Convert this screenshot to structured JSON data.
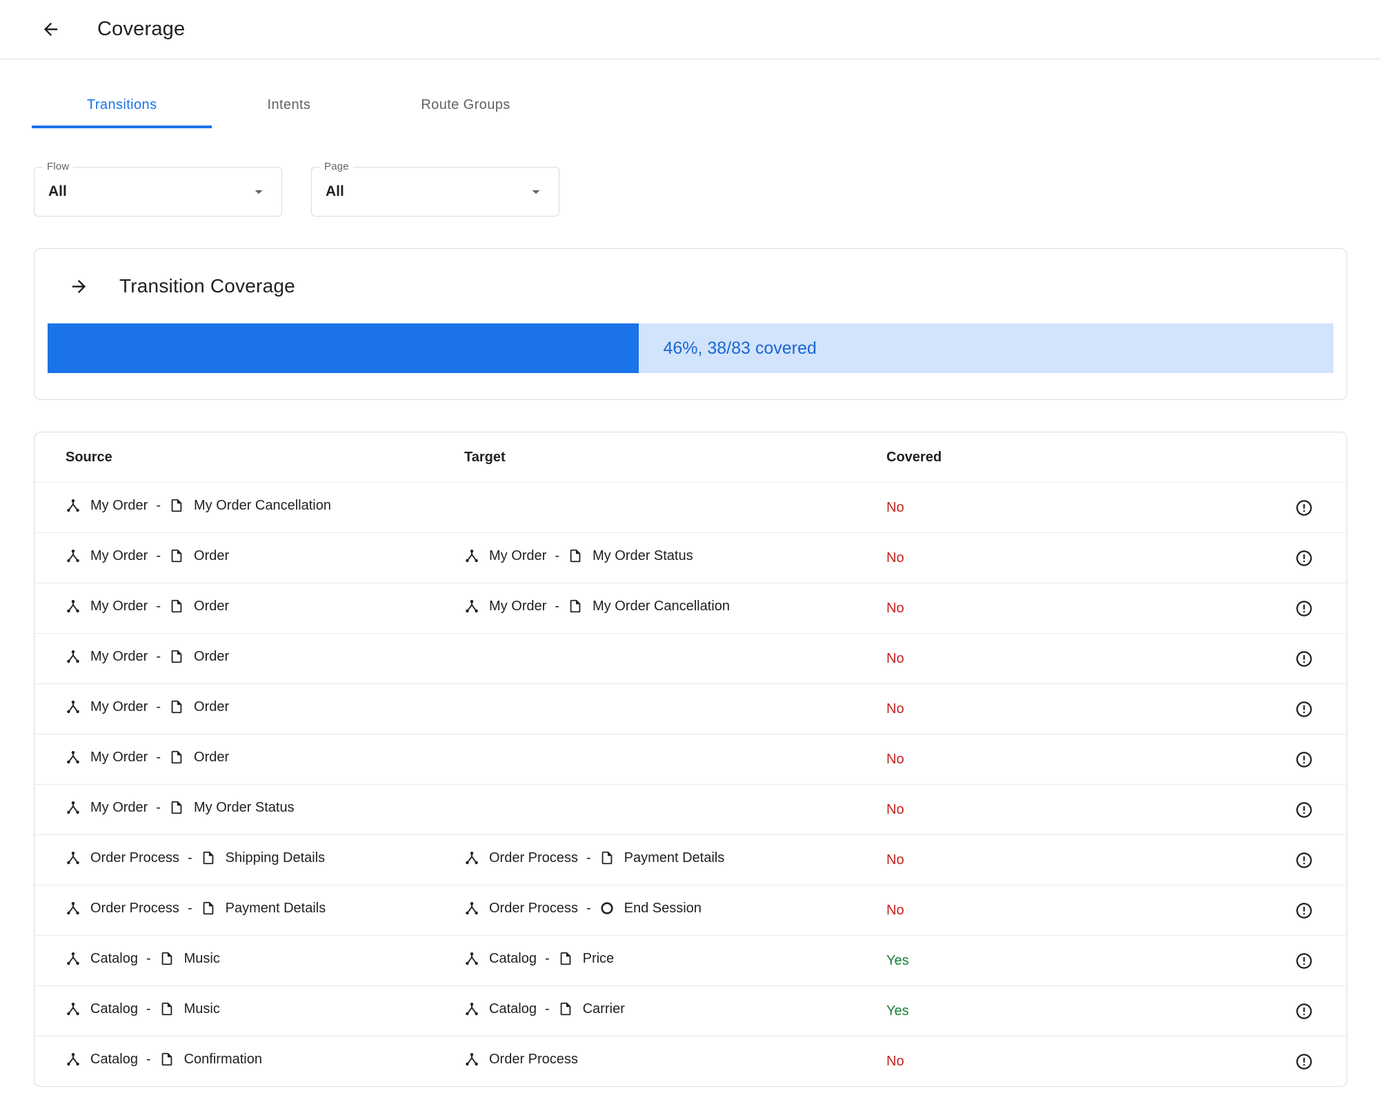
{
  "header": {
    "title": "Coverage"
  },
  "tabs": [
    {
      "label": "Transitions",
      "active": true
    },
    {
      "label": "Intents",
      "active": false
    },
    {
      "label": "Route Groups",
      "active": false
    }
  ],
  "filters": {
    "flow": {
      "label": "Flow",
      "value": "All"
    },
    "page": {
      "label": "Page",
      "value": "All"
    }
  },
  "coverage_card": {
    "title": "Transition Coverage",
    "progress_percent": 46,
    "progress_label": "46%, 38/83 covered"
  },
  "table": {
    "columns": [
      "Source",
      "Target",
      "Covered"
    ],
    "rows": [
      {
        "source": {
          "flow": "My Order",
          "page": "My Order Cancellation",
          "page_icon": "page"
        },
        "target": null,
        "covered": "No"
      },
      {
        "source": {
          "flow": "My Order",
          "page": "Order",
          "page_icon": "page"
        },
        "target": {
          "flow": "My Order",
          "page": "My Order Status",
          "page_icon": "page"
        },
        "covered": "No"
      },
      {
        "source": {
          "flow": "My Order",
          "page": "Order",
          "page_icon": "page"
        },
        "target": {
          "flow": "My Order",
          "page": "My Order Cancellation",
          "page_icon": "page"
        },
        "covered": "No"
      },
      {
        "source": {
          "flow": "My Order",
          "page": "Order",
          "page_icon": "page"
        },
        "target": null,
        "covered": "No"
      },
      {
        "source": {
          "flow": "My Order",
          "page": "Order",
          "page_icon": "page"
        },
        "target": null,
        "covered": "No"
      },
      {
        "source": {
          "flow": "My Order",
          "page": "Order",
          "page_icon": "page"
        },
        "target": null,
        "covered": "No"
      },
      {
        "source": {
          "flow": "My Order",
          "page": "My Order Status",
          "page_icon": "page"
        },
        "target": null,
        "covered": "No"
      },
      {
        "source": {
          "flow": "Order Process",
          "page": "Shipping Details",
          "page_icon": "page"
        },
        "target": {
          "flow": "Order Process",
          "page": "Payment Details",
          "page_icon": "page"
        },
        "covered": "No"
      },
      {
        "source": {
          "flow": "Order Process",
          "page": "Payment Details",
          "page_icon": "page"
        },
        "target": {
          "flow": "Order Process",
          "page": "End Session",
          "page_icon": "end-session"
        },
        "covered": "No"
      },
      {
        "source": {
          "flow": "Catalog",
          "page": "Music",
          "page_icon": "page"
        },
        "target": {
          "flow": "Catalog",
          "page": "Price",
          "page_icon": "page"
        },
        "covered": "Yes"
      },
      {
        "source": {
          "flow": "Catalog",
          "page": "Music",
          "page_icon": "page"
        },
        "target": {
          "flow": "Catalog",
          "page": "Carrier",
          "page_icon": "page"
        },
        "covered": "Yes"
      },
      {
        "source": {
          "flow": "Catalog",
          "page": "Confirmation",
          "page_icon": "page"
        },
        "target": {
          "flow": "Order Process",
          "page": null
        },
        "covered": "No"
      }
    ]
  },
  "icons": {
    "back": "arrow-back",
    "transition": "arrow-forward",
    "flow": "flow-graph",
    "page": "document-page",
    "end_session": "circle-outline",
    "row_info": "error-outline",
    "dropdown": "caret-down"
  },
  "colors": {
    "accent": "#1a73e8",
    "progress_bg": "#d2e3fc",
    "progress_text": "#1967d2",
    "no": "#c5221f",
    "yes": "#188038"
  }
}
